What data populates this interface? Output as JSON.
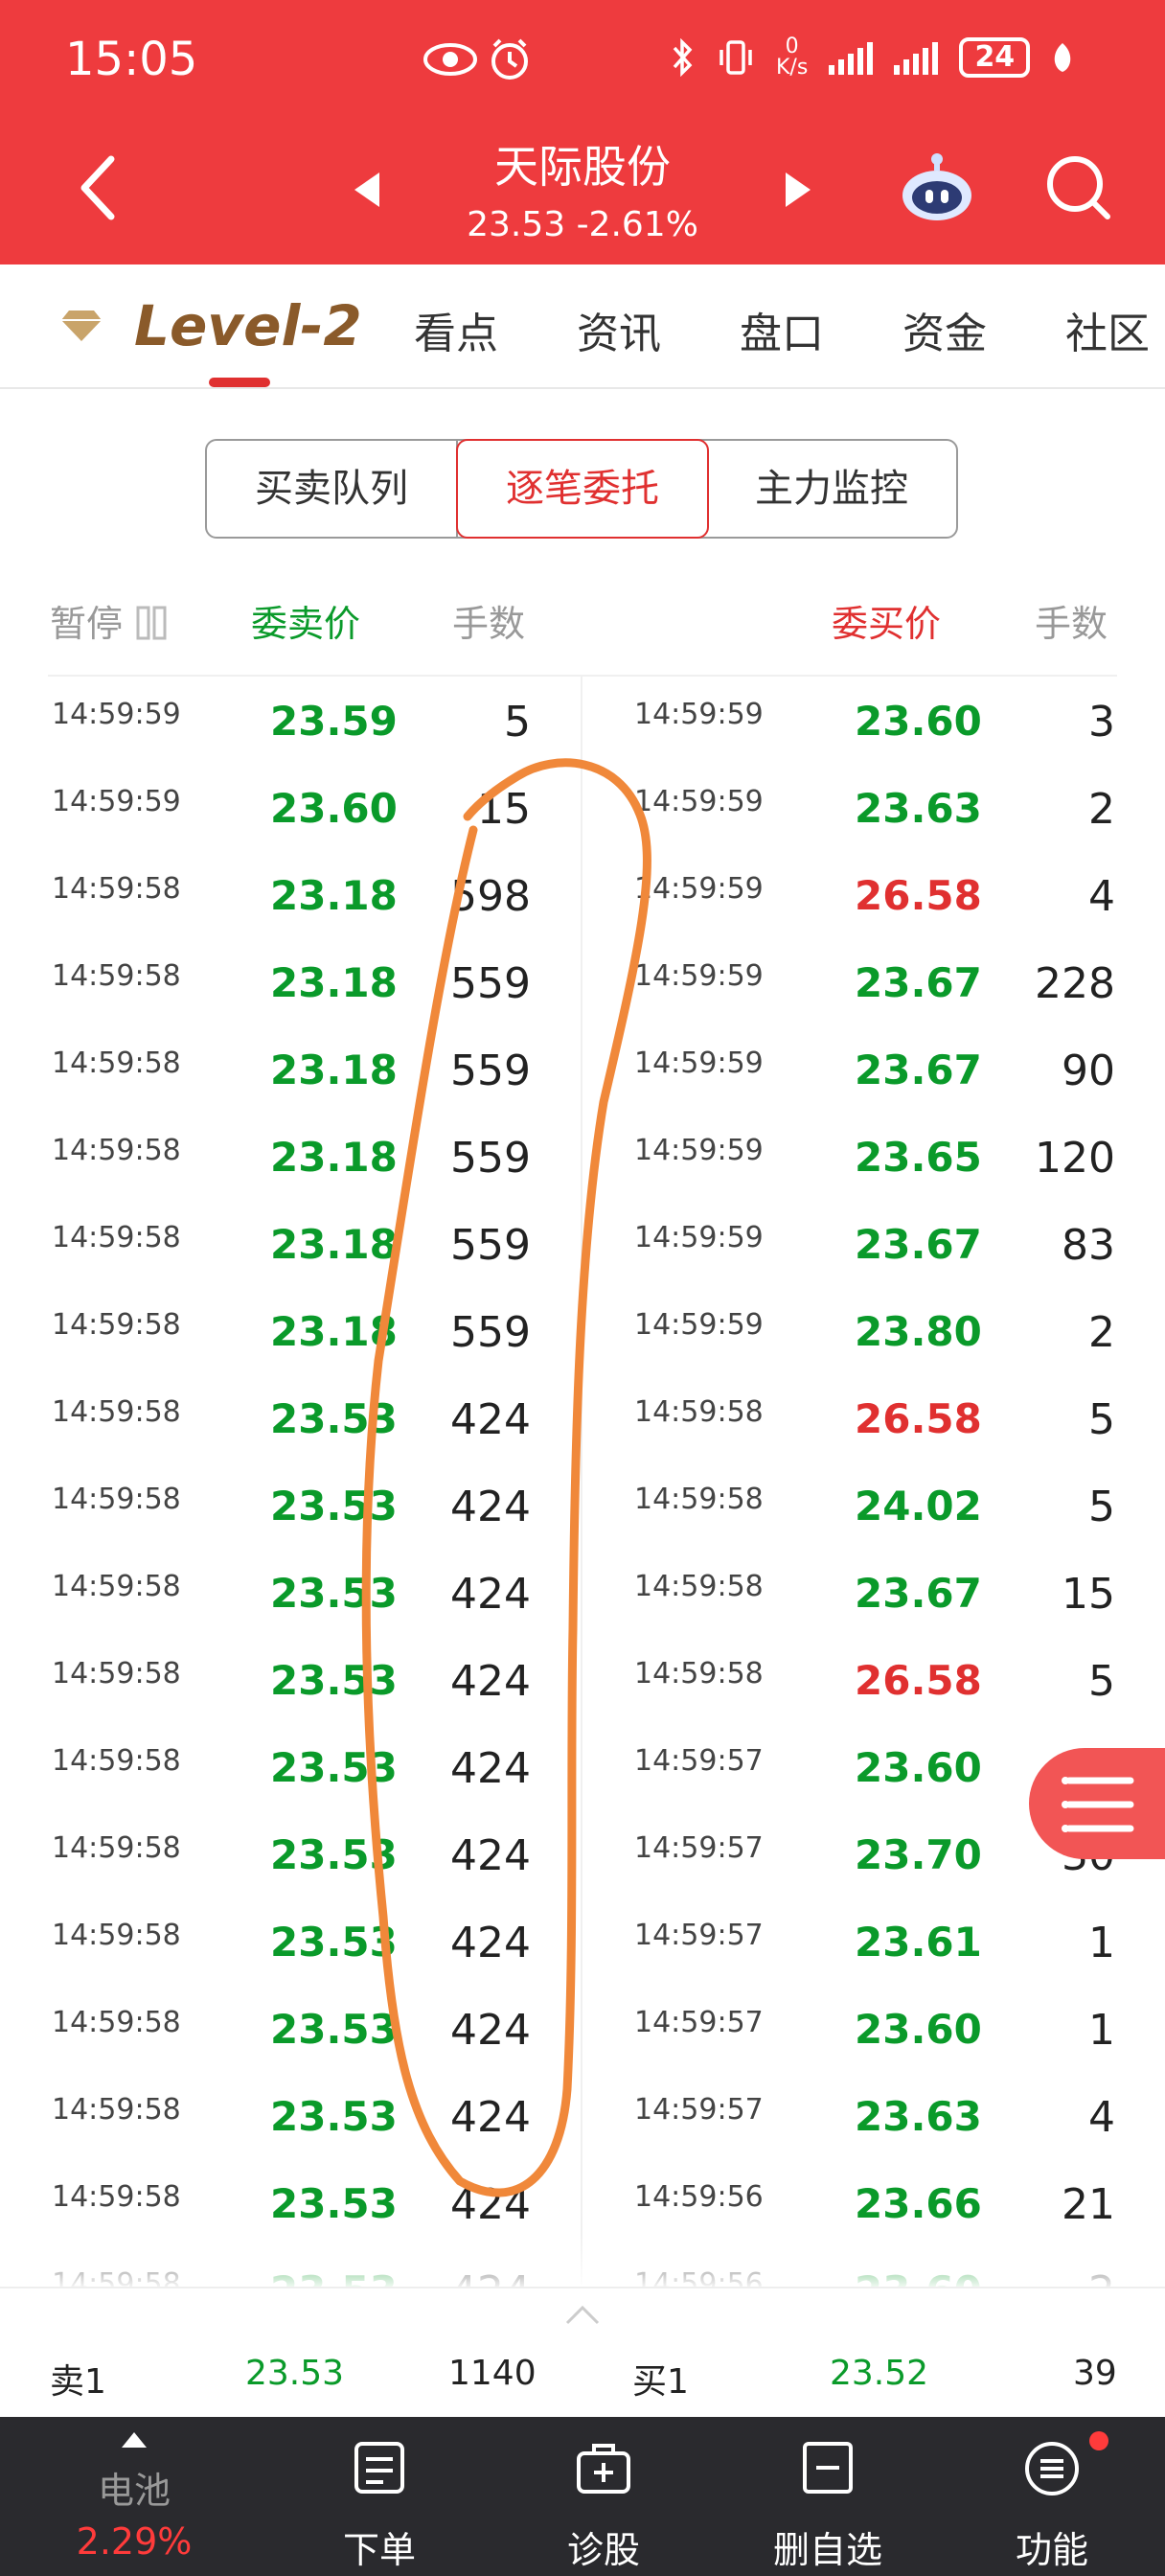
{
  "status_bar": {
    "time": "15:05",
    "net_speed_top": "0",
    "net_speed_bottom": "K/s",
    "battery": "24"
  },
  "header": {
    "stock_name": "天际股份",
    "price_line": "23.53 -2.61%"
  },
  "tabs": [
    "Level-2",
    "看点",
    "资讯",
    "盘口",
    "资金",
    "社区"
  ],
  "segments": [
    "买卖队列",
    "逐笔委托",
    "主力监控"
  ],
  "columns": {
    "pause": "暂停",
    "sell_price": "委卖价",
    "sell_qty": "手数",
    "buy_price": "委买价",
    "buy_qty": "手数"
  },
  "rows": [
    {
      "st": "14:59:59",
      "sp": "23.59",
      "sq": "5",
      "bt": "14:59:59",
      "bp": "23.60",
      "bc": "green",
      "bq": "3"
    },
    {
      "st": "14:59:59",
      "sp": "23.60",
      "sq": "15",
      "bt": "14:59:59",
      "bp": "23.63",
      "bc": "green",
      "bq": "2"
    },
    {
      "st": "14:59:58",
      "sp": "23.18",
      "sq": "598",
      "bt": "14:59:59",
      "bp": "26.58",
      "bc": "red",
      "bq": "4"
    },
    {
      "st": "14:59:58",
      "sp": "23.18",
      "sq": "559",
      "bt": "14:59:59",
      "bp": "23.67",
      "bc": "green",
      "bq": "228"
    },
    {
      "st": "14:59:58",
      "sp": "23.18",
      "sq": "559",
      "bt": "14:59:59",
      "bp": "23.67",
      "bc": "green",
      "bq": "90"
    },
    {
      "st": "14:59:58",
      "sp": "23.18",
      "sq": "559",
      "bt": "14:59:59",
      "bp": "23.65",
      "bc": "green",
      "bq": "120"
    },
    {
      "st": "14:59:58",
      "sp": "23.18",
      "sq": "559",
      "bt": "14:59:59",
      "bp": "23.67",
      "bc": "green",
      "bq": "83"
    },
    {
      "st": "14:59:58",
      "sp": "23.18",
      "sq": "559",
      "bt": "14:59:59",
      "bp": "23.80",
      "bc": "green",
      "bq": "2"
    },
    {
      "st": "14:59:58",
      "sp": "23.53",
      "sq": "424",
      "bt": "14:59:58",
      "bp": "26.58",
      "bc": "red",
      "bq": "5"
    },
    {
      "st": "14:59:58",
      "sp": "23.53",
      "sq": "424",
      "bt": "14:59:58",
      "bp": "24.02",
      "bc": "green",
      "bq": "5"
    },
    {
      "st": "14:59:58",
      "sp": "23.53",
      "sq": "424",
      "bt": "14:59:58",
      "bp": "23.67",
      "bc": "green",
      "bq": "15"
    },
    {
      "st": "14:59:58",
      "sp": "23.53",
      "sq": "424",
      "bt": "14:59:58",
      "bp": "26.58",
      "bc": "red",
      "bq": "5"
    },
    {
      "st": "14:59:58",
      "sp": "23.53",
      "sq": "424",
      "bt": "14:59:57",
      "bp": "23.60",
      "bc": "green",
      "bq": "3"
    },
    {
      "st": "14:59:58",
      "sp": "23.53",
      "sq": "424",
      "bt": "14:59:57",
      "bp": "23.70",
      "bc": "green",
      "bq": "30"
    },
    {
      "st": "14:59:58",
      "sp": "23.53",
      "sq": "424",
      "bt": "14:59:57",
      "bp": "23.61",
      "bc": "green",
      "bq": "1"
    },
    {
      "st": "14:59:58",
      "sp": "23.53",
      "sq": "424",
      "bt": "14:59:57",
      "bp": "23.60",
      "bc": "green",
      "bq": "1"
    },
    {
      "st": "14:59:58",
      "sp": "23.53",
      "sq": "424",
      "bt": "14:59:57",
      "bp": "23.63",
      "bc": "green",
      "bq": "4"
    },
    {
      "st": "14:59:58",
      "sp": "23.53",
      "sq": "424",
      "bt": "14:59:56",
      "bp": "23.66",
      "bc": "green",
      "bq": "21"
    },
    {
      "st": "14:59:58",
      "sp": "23.53",
      "sq": "424",
      "bt": "14:59:56",
      "bp": "23.60",
      "bc": "green",
      "bq": "2"
    }
  ],
  "bottom_quote": {
    "sell_label": "卖1",
    "sell_price": "23.53",
    "sell_qty": "1140",
    "buy_label": "买1",
    "buy_price": "23.52",
    "buy_qty": "39"
  },
  "bottom_nav": [
    {
      "label": "电池",
      "sub": "2.29%"
    },
    {
      "label": "下单"
    },
    {
      "label": "诊股"
    },
    {
      "label": "删自选"
    },
    {
      "label": "功能"
    }
  ],
  "colors": {
    "brand_red": "#ee3b3e",
    "price_green": "#0a9a2a",
    "price_red": "#e03030",
    "annotation_orange": "#f0883a"
  }
}
